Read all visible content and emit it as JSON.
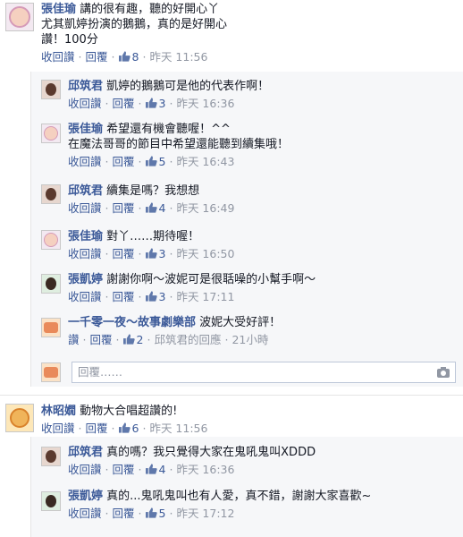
{
  "colors": {
    "link": "#3b5998",
    "meta": "#9197a3",
    "reply_background": "#f6f7f9"
  },
  "comments": [
    {
      "name": "張佳瑜",
      "text_lines": [
        "講的很有趣，聽的好開心丫",
        "尤其凱婷扮演的鵝鵝，真的是好開心",
        "讚！100分"
      ],
      "actions": {
        "unlike": "收回讚",
        "reply": "回覆",
        "likes": "8",
        "time": "昨天 11:56"
      },
      "replies": [
        {
          "name": "邱筑君",
          "text": "凱婷的鵝鵝可是他的代表作啊！",
          "actions": {
            "unlike": "收回讚",
            "reply": "回覆",
            "likes": "3",
            "time": "昨天 16:36"
          }
        },
        {
          "name": "張佳瑜",
          "text_lines": [
            "希望還有機會聽喔！^^",
            "在魔法哥哥的節目中希望還能聽到續集哦！"
          ],
          "actions": {
            "unlike": "收回讚",
            "reply": "回覆",
            "likes": "5",
            "time": "昨天 16:43"
          }
        },
        {
          "name": "邱筑君",
          "text": "續集是嗎？我想想",
          "actions": {
            "unlike": "收回讚",
            "reply": "回覆",
            "likes": "4",
            "time": "昨天 16:49"
          }
        },
        {
          "name": "張佳瑜",
          "text": "對丫……期待喔！",
          "actions": {
            "unlike": "收回讚",
            "reply": "回覆",
            "likes": "3",
            "time": "昨天 16:50"
          }
        },
        {
          "name": "張凱婷",
          "text": "謝謝你啊～波妮可是很聒噪的小幫手啊～",
          "actions": {
            "unlike": "收回讚",
            "reply": "回覆",
            "likes": "3",
            "time": "昨天 17:11"
          }
        },
        {
          "name": "一千零一夜～故事劇樂部",
          "text": "波妮大受好評！",
          "actions": {
            "like": "讚",
            "reply": "回覆",
            "likes": "2",
            "liked_by": "邱筑君的回應",
            "time": "21小時"
          }
        }
      ],
      "reply_placeholder": "回覆……"
    },
    {
      "name": "林昭嫺",
      "text": "動物大合唱超讚的!",
      "actions": {
        "unlike": "收回讚",
        "reply": "回覆",
        "likes": "6",
        "time": "昨天 11:56"
      },
      "replies": [
        {
          "name": "邱筑君",
          "text": "真的嗎？我只覺得大家在鬼吼鬼叫XDDD",
          "actions": {
            "unlike": "收回讚",
            "reply": "回覆",
            "likes": "4",
            "time": "昨天 16:36"
          }
        },
        {
          "name": "張凱婷",
          "text": "真的...鬼吼鬼叫也有人愛，真不錯，謝謝大家喜歡~",
          "actions": {
            "unlike": "收回讚",
            "reply": "回覆",
            "likes": "5",
            "time": "昨天 17:12"
          }
        }
      ]
    }
  ]
}
